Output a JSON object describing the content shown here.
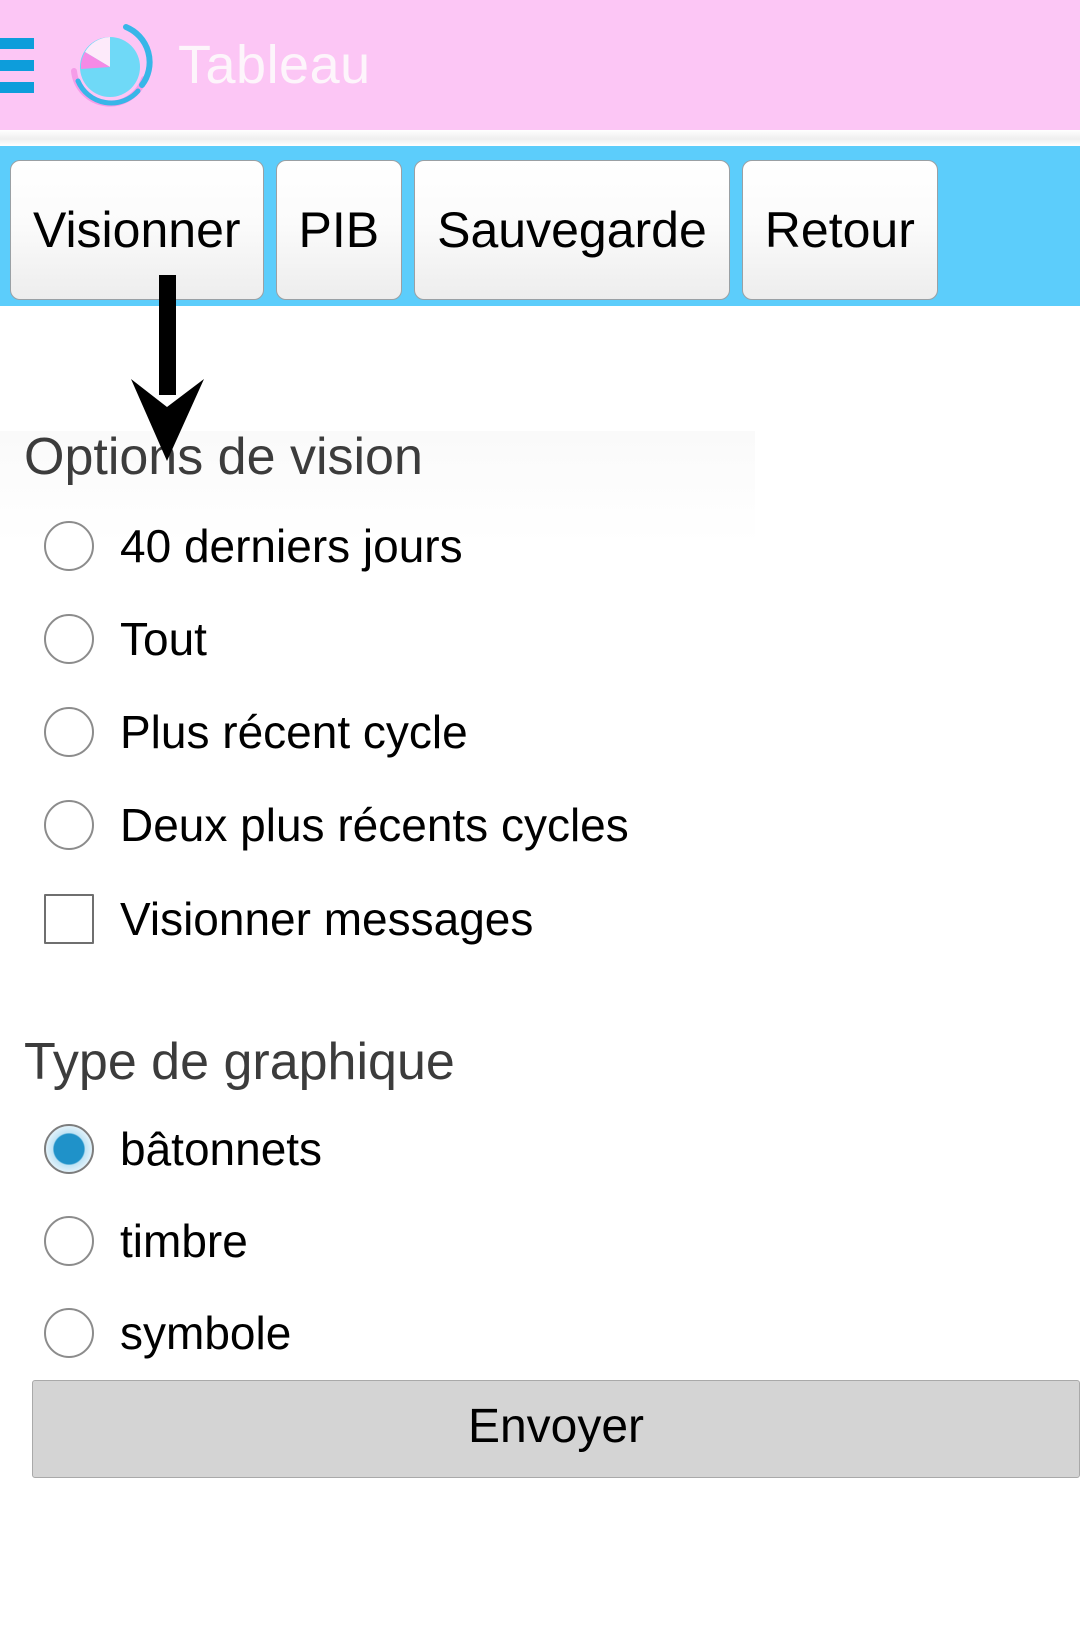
{
  "header": {
    "menu_icon": "hamburger-menu-icon",
    "logo_icon": "pie-chart-logo-icon",
    "title": "Tableau",
    "bar_color": "#fcc6f5",
    "menu_color": "#0d9ddb"
  },
  "tabs": {
    "bar_color": "#5ccdfb",
    "items": [
      {
        "label": "Visionner"
      },
      {
        "label": "PIB"
      },
      {
        "label": "Sauvegarde"
      },
      {
        "label": "Retour"
      }
    ]
  },
  "annotation": {
    "arrow_icon": "down-arrow-annotation-icon",
    "color": "#000000",
    "points_to": "Visionner"
  },
  "vision_options": {
    "legend": "Options de vision",
    "radios": [
      {
        "label": "40 derniers jours",
        "checked": false
      },
      {
        "label": "Tout",
        "checked": false
      },
      {
        "label": "Plus récent cycle",
        "checked": false
      },
      {
        "label": "Deux plus récents cycles",
        "checked": false
      }
    ],
    "checkboxes": [
      {
        "label": "Visionner messages",
        "checked": false
      }
    ]
  },
  "chart_type": {
    "legend": "Type de graphique",
    "radios": [
      {
        "label": "bâtonnets",
        "checked": true
      },
      {
        "label": "timbre",
        "checked": false
      },
      {
        "label": "symbole",
        "checked": false
      }
    ],
    "selected_color": "#1f92c9"
  },
  "submit": {
    "label": "Envoyer"
  }
}
